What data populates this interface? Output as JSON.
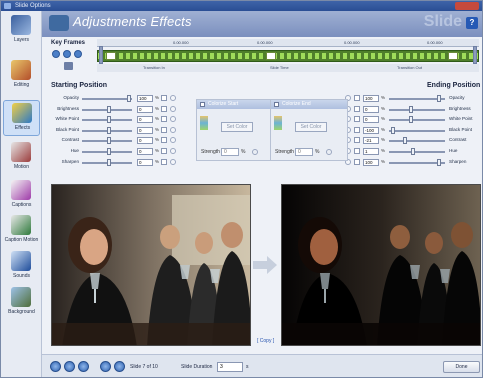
{
  "window": {
    "title": "Slide Options"
  },
  "sidebar": {
    "items": [
      {
        "label": "Layers",
        "icon": "layers-icon"
      },
      {
        "label": "Editing",
        "icon": "editing-icon"
      },
      {
        "label": "Effects",
        "icon": "effects-icon",
        "selected": true
      },
      {
        "label": "Motion",
        "icon": "motion-icon"
      },
      {
        "label": "Captions",
        "icon": "captions-icon"
      },
      {
        "label": "Caption Motion",
        "icon": "caption-motion-icon"
      },
      {
        "label": "Sounds",
        "icon": "sounds-icon"
      },
      {
        "label": "Background",
        "icon": "background-icon"
      }
    ]
  },
  "header": {
    "title": "Adjustments Effects",
    "brand": "Slide",
    "help": "?"
  },
  "keyframes": {
    "label": "Key Frames",
    "ruler_ticks": [
      "0.00.000",
      "0.00.000",
      "0.00.000",
      "0.00.000"
    ],
    "segment_labels": [
      "Transition In",
      "Slide Time",
      "Transition Out"
    ]
  },
  "start": {
    "title": "Starting Position",
    "rows": [
      {
        "label": "Opacity",
        "value": "100",
        "unit": "%"
      },
      {
        "label": "Brightness",
        "value": "0",
        "unit": "%"
      },
      {
        "label": "White Point",
        "value": "0",
        "unit": "%"
      },
      {
        "label": "Black Point",
        "value": "0",
        "unit": "%"
      },
      {
        "label": "Contrast",
        "value": "0",
        "unit": "%"
      },
      {
        "label": "Hue",
        "value": "0",
        "unit": "%"
      },
      {
        "label": "Sharpen",
        "value": "0",
        "unit": "%"
      }
    ]
  },
  "end": {
    "title": "Ending Position",
    "rows": [
      {
        "label": "Opacity",
        "value": "100",
        "unit": "%"
      },
      {
        "label": "Brightness",
        "value": "0",
        "unit": "%"
      },
      {
        "label": "White Point",
        "value": "0",
        "unit": "%"
      },
      {
        "label": "Black Point",
        "value": "-100",
        "unit": "%"
      },
      {
        "label": "Contrast",
        "value": "-21",
        "unit": "%"
      },
      {
        "label": "Hue",
        "value": "1",
        "unit": "%"
      },
      {
        "label": "Sharpen",
        "value": "100",
        "unit": "%"
      }
    ]
  },
  "colorize_start": {
    "title": "Colorize Start",
    "set_color": "Set Color",
    "strength_label": "Strength",
    "strength_value": "0",
    "unit": "%"
  },
  "colorize_end": {
    "title": "Colorize End",
    "set_color": "Set Color",
    "strength_label": "Strength",
    "strength_value": "0",
    "unit": "%"
  },
  "preview": {
    "copy_label": "[ Copy ]"
  },
  "bottom": {
    "slide_info": "Slide 7 of 10",
    "duration_label": "Slide Duration",
    "duration_value": "3",
    "duration_unit": "s",
    "done_label": "Done"
  },
  "colors": {
    "header": "#7b8fbe",
    "timeline_green": "#4f7f2b",
    "accent": "#2559b5"
  }
}
